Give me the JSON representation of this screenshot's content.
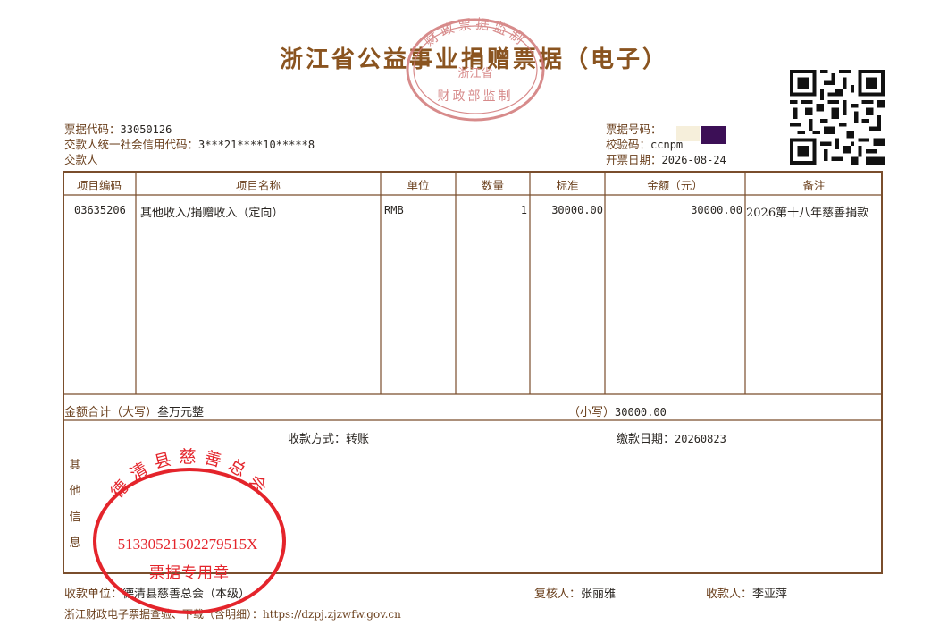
{
  "title": "浙江省公益事业捐赠票据（电子）",
  "seal_top": {
    "text_top": "财政票据监制",
    "text_mid": "浙江省",
    "text_bottom": "财政部监制"
  },
  "header": {
    "code_label": "票据代码：",
    "code_value": "33050126",
    "credit_label": "交款人统一社会信用代码：",
    "credit_value": "3***21****10*****8",
    "payer_label": "交款人",
    "number_label": "票据号码：",
    "check_label": "校验码：",
    "check_value": "ccnpm",
    "date_label": "开票日期：",
    "date_value": "2026-08-24"
  },
  "table": {
    "columns": [
      "项目编码",
      "项目名称",
      "单位",
      "数量",
      "标准",
      "金额（元）",
      "备注"
    ],
    "rows": [
      {
        "code": "03635206",
        "name": "其他收入/捐赠收入（定向）",
        "unit": "RMB",
        "qty": "1",
        "std": "30000.00",
        "amount": "30000.00",
        "note": "2026第十八年慈善捐款"
      }
    ]
  },
  "total": {
    "upper_label": "金额合计（大写）",
    "upper_value": "叁万元整",
    "lower_label": "（小写）",
    "lower_value": "30000.00"
  },
  "payment": {
    "method_label": "收款方式：",
    "method_value": "转账",
    "date_label": "缴款日期：",
    "date_value": "20260823"
  },
  "other_info": [
    "其",
    "他",
    "信",
    "息"
  ],
  "seal_red": {
    "org": "德清县慈善总会",
    "number": "51330521502279515X",
    "usage": "票据专用章"
  },
  "footer": {
    "unit_label": "收款单位：",
    "unit_value": "德清县慈善总会（本级）",
    "reviewer_label": "复核人：",
    "reviewer_value": "张丽雅",
    "receiver_label": "收款人：",
    "receiver_value": "李亚萍",
    "query_text": "浙江财政电子票据查验、下载（含明细）：https://dzpj.zjzwfw.gov.cn"
  },
  "colors": {
    "brown": "#6a3f1c",
    "seal_pink": "#cf6b6b",
    "seal_red": "#e4242b"
  }
}
